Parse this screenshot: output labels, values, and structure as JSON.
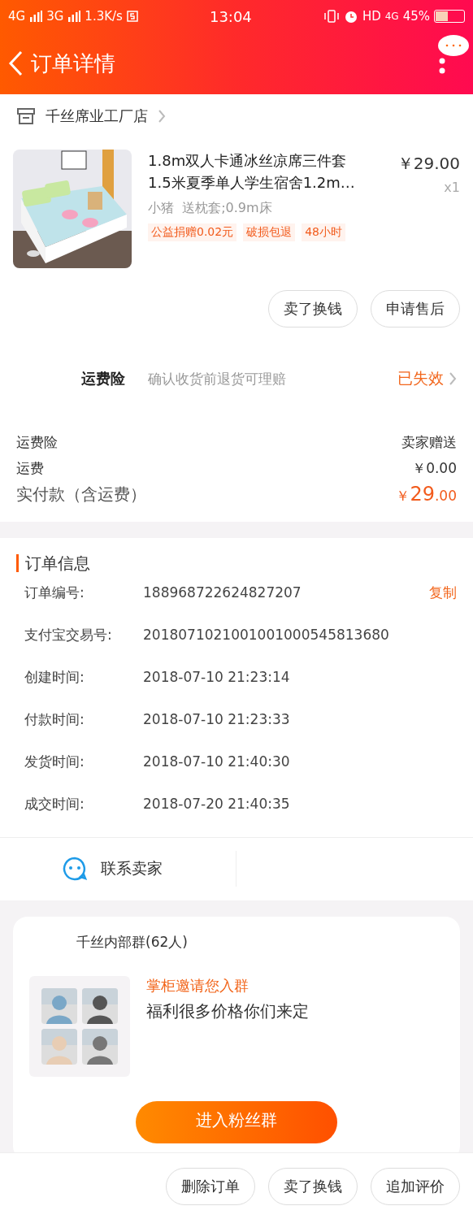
{
  "status_bar": {
    "network_1": "4G",
    "network_2": "3G",
    "speed": "1.3K/s",
    "time": "13:04",
    "hd": "HD",
    "network_3": "4G",
    "battery": "45%"
  },
  "header": {
    "title": "订单详情"
  },
  "shop": {
    "name": "千丝席业工厂店"
  },
  "product": {
    "kind": "picture",
    "title": "1.8m双人卡通冰丝凉席三件套1.5米夏季单人学生宿舍1.2m…",
    "variant": "小猪  送枕套;0.9m床",
    "price": "￥29.00",
    "quantity": "x1",
    "tags": [
      "公益捐赠0.02元",
      "破损包退",
      "48小时"
    ]
  },
  "item_actions": [
    "卖了换钱",
    "申请售后"
  ],
  "insurance": {
    "label": "运费险",
    "description": "确认收货前退货可理赔",
    "status": "已失效"
  },
  "summary": [
    {
      "label": "运费险",
      "value": "卖家赠送"
    },
    {
      "label": "运费",
      "value": "￥0.00"
    }
  ],
  "total": {
    "label": "实付款（含运费）",
    "currency": "￥",
    "integer": "29",
    "decimal": ".00"
  },
  "order_info": {
    "title": "订单信息",
    "rows": [
      {
        "label": "订单编号:",
        "value": "188968722624827207",
        "action": "复制"
      },
      {
        "label": "支付宝交易号:",
        "value": "2018071021001001000545813680"
      },
      {
        "label": "创建时间:",
        "value": "2018-07-10 21:23:14"
      },
      {
        "label": "付款时间:",
        "value": "2018-07-10 21:23:33"
      },
      {
        "label": "发货时间:",
        "value": "2018-07-10 21:40:30"
      },
      {
        "label": "成交时间:",
        "value": "2018-07-20 21:40:35"
      }
    ]
  },
  "contact": {
    "label": "联系卖家"
  },
  "group_card": {
    "name": "千丝内部群(62人)",
    "invite": "掌柜邀请您入群",
    "message": "福利很多价格你们来定",
    "join_button": "进入粉丝群"
  },
  "bottom_actions": [
    "删除订单",
    "卖了换钱",
    "追加评价"
  ]
}
